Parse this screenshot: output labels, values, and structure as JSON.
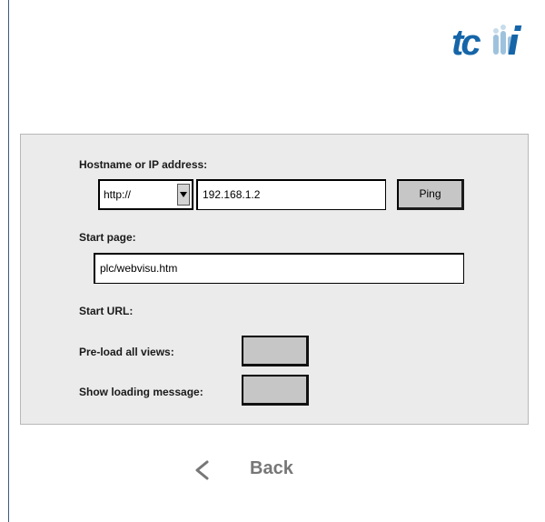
{
  "logo": {
    "text": "tcmi",
    "color": "#1565a8",
    "icon": "tcmi-logo"
  },
  "form": {
    "hostname_label": "Hostname or IP address:",
    "protocol": {
      "value": "http://",
      "icon": "dropdown-arrow-icon"
    },
    "hostname_value": "192.168.1.2",
    "ping_label": "Ping",
    "start_page_label": "Start page:",
    "start_page_value": "plc/webvisu.htm",
    "start_url_label": "Start URL:",
    "preload_label": "Pre-load all views:",
    "loading_msg_label": "Show loading message:"
  },
  "nav": {
    "back_label": "Back",
    "back_icon": "chevron-left-icon"
  },
  "colors": {
    "panel_bg": "#ebebeb",
    "button_bg": "#c6c6c6",
    "back_text": "#777777",
    "logo_blue": "#1565a8"
  }
}
